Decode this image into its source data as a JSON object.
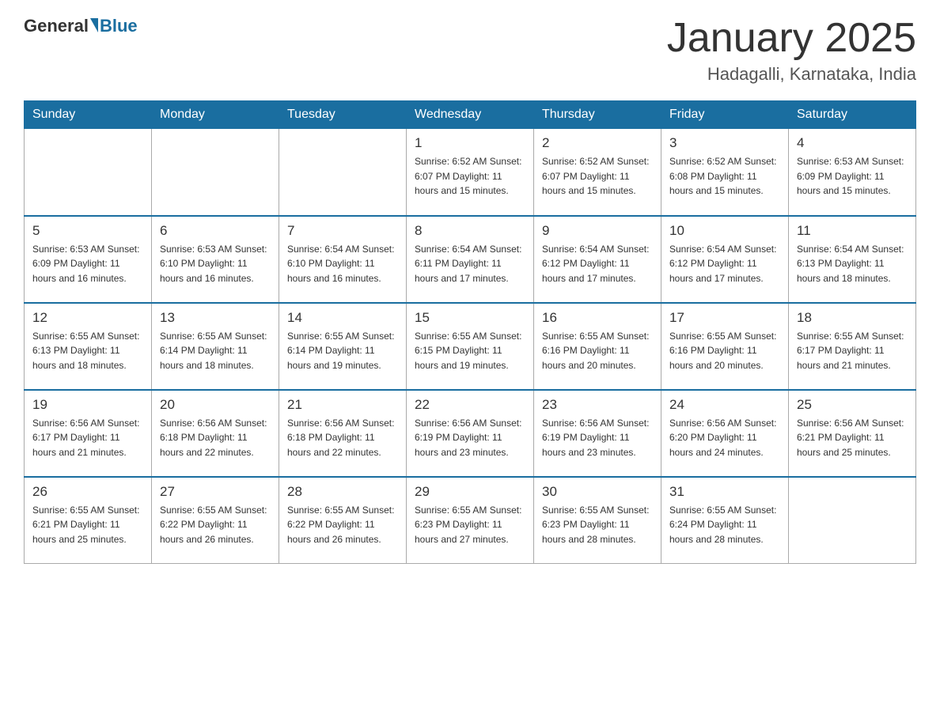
{
  "header": {
    "logo_general": "General",
    "logo_blue": "Blue",
    "month_title": "January 2025",
    "location": "Hadagalli, Karnataka, India"
  },
  "days_of_week": [
    "Sunday",
    "Monday",
    "Tuesday",
    "Wednesday",
    "Thursday",
    "Friday",
    "Saturday"
  ],
  "weeks": [
    [
      {
        "day": "",
        "info": ""
      },
      {
        "day": "",
        "info": ""
      },
      {
        "day": "",
        "info": ""
      },
      {
        "day": "1",
        "info": "Sunrise: 6:52 AM\nSunset: 6:07 PM\nDaylight: 11 hours\nand 15 minutes."
      },
      {
        "day": "2",
        "info": "Sunrise: 6:52 AM\nSunset: 6:07 PM\nDaylight: 11 hours\nand 15 minutes."
      },
      {
        "day": "3",
        "info": "Sunrise: 6:52 AM\nSunset: 6:08 PM\nDaylight: 11 hours\nand 15 minutes."
      },
      {
        "day": "4",
        "info": "Sunrise: 6:53 AM\nSunset: 6:09 PM\nDaylight: 11 hours\nand 15 minutes."
      }
    ],
    [
      {
        "day": "5",
        "info": "Sunrise: 6:53 AM\nSunset: 6:09 PM\nDaylight: 11 hours\nand 16 minutes."
      },
      {
        "day": "6",
        "info": "Sunrise: 6:53 AM\nSunset: 6:10 PM\nDaylight: 11 hours\nand 16 minutes."
      },
      {
        "day": "7",
        "info": "Sunrise: 6:54 AM\nSunset: 6:10 PM\nDaylight: 11 hours\nand 16 minutes."
      },
      {
        "day": "8",
        "info": "Sunrise: 6:54 AM\nSunset: 6:11 PM\nDaylight: 11 hours\nand 17 minutes."
      },
      {
        "day": "9",
        "info": "Sunrise: 6:54 AM\nSunset: 6:12 PM\nDaylight: 11 hours\nand 17 minutes."
      },
      {
        "day": "10",
        "info": "Sunrise: 6:54 AM\nSunset: 6:12 PM\nDaylight: 11 hours\nand 17 minutes."
      },
      {
        "day": "11",
        "info": "Sunrise: 6:54 AM\nSunset: 6:13 PM\nDaylight: 11 hours\nand 18 minutes."
      }
    ],
    [
      {
        "day": "12",
        "info": "Sunrise: 6:55 AM\nSunset: 6:13 PM\nDaylight: 11 hours\nand 18 minutes."
      },
      {
        "day": "13",
        "info": "Sunrise: 6:55 AM\nSunset: 6:14 PM\nDaylight: 11 hours\nand 18 minutes."
      },
      {
        "day": "14",
        "info": "Sunrise: 6:55 AM\nSunset: 6:14 PM\nDaylight: 11 hours\nand 19 minutes."
      },
      {
        "day": "15",
        "info": "Sunrise: 6:55 AM\nSunset: 6:15 PM\nDaylight: 11 hours\nand 19 minutes."
      },
      {
        "day": "16",
        "info": "Sunrise: 6:55 AM\nSunset: 6:16 PM\nDaylight: 11 hours\nand 20 minutes."
      },
      {
        "day": "17",
        "info": "Sunrise: 6:55 AM\nSunset: 6:16 PM\nDaylight: 11 hours\nand 20 minutes."
      },
      {
        "day": "18",
        "info": "Sunrise: 6:55 AM\nSunset: 6:17 PM\nDaylight: 11 hours\nand 21 minutes."
      }
    ],
    [
      {
        "day": "19",
        "info": "Sunrise: 6:56 AM\nSunset: 6:17 PM\nDaylight: 11 hours\nand 21 minutes."
      },
      {
        "day": "20",
        "info": "Sunrise: 6:56 AM\nSunset: 6:18 PM\nDaylight: 11 hours\nand 22 minutes."
      },
      {
        "day": "21",
        "info": "Sunrise: 6:56 AM\nSunset: 6:18 PM\nDaylight: 11 hours\nand 22 minutes."
      },
      {
        "day": "22",
        "info": "Sunrise: 6:56 AM\nSunset: 6:19 PM\nDaylight: 11 hours\nand 23 minutes."
      },
      {
        "day": "23",
        "info": "Sunrise: 6:56 AM\nSunset: 6:19 PM\nDaylight: 11 hours\nand 23 minutes."
      },
      {
        "day": "24",
        "info": "Sunrise: 6:56 AM\nSunset: 6:20 PM\nDaylight: 11 hours\nand 24 minutes."
      },
      {
        "day": "25",
        "info": "Sunrise: 6:56 AM\nSunset: 6:21 PM\nDaylight: 11 hours\nand 25 minutes."
      }
    ],
    [
      {
        "day": "26",
        "info": "Sunrise: 6:55 AM\nSunset: 6:21 PM\nDaylight: 11 hours\nand 25 minutes."
      },
      {
        "day": "27",
        "info": "Sunrise: 6:55 AM\nSunset: 6:22 PM\nDaylight: 11 hours\nand 26 minutes."
      },
      {
        "day": "28",
        "info": "Sunrise: 6:55 AM\nSunset: 6:22 PM\nDaylight: 11 hours\nand 26 minutes."
      },
      {
        "day": "29",
        "info": "Sunrise: 6:55 AM\nSunset: 6:23 PM\nDaylight: 11 hours\nand 27 minutes."
      },
      {
        "day": "30",
        "info": "Sunrise: 6:55 AM\nSunset: 6:23 PM\nDaylight: 11 hours\nand 28 minutes."
      },
      {
        "day": "31",
        "info": "Sunrise: 6:55 AM\nSunset: 6:24 PM\nDaylight: 11 hours\nand 28 minutes."
      },
      {
        "day": "",
        "info": ""
      }
    ]
  ]
}
